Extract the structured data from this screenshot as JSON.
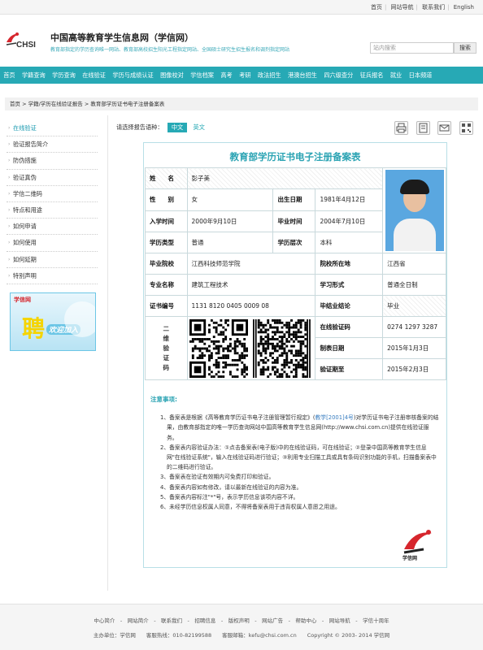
{
  "topbar": {
    "links": [
      "首页",
      "网站导航",
      "联系我们",
      "English"
    ]
  },
  "header": {
    "title": "中国高等教育学生信息网（学信网）",
    "logo_text": "CHSI",
    "subtitle": "教育部指定的学历查询唯一网站、教育部高校招生阳光工程指定网站、全国硕士研究生招生报名和调剂指定网站",
    "search_placeholder": "站内搜索",
    "search_button": "搜索"
  },
  "nav": [
    "首页",
    "学籍查询",
    "学历查询",
    "在线验证",
    "学历与成绩认证",
    "图像校对",
    "学信档案",
    "高考",
    "考研",
    "政法招生",
    "港澳台招生",
    "四六级查分",
    "征兵报名",
    "就业",
    "日本频道"
  ],
  "breadcrumb": "首页 > 学籍/学历在线验证报告 > 教育部学历证书电子注册备案表",
  "sidebar": {
    "items": [
      {
        "label": "在线验证",
        "active": true
      },
      {
        "label": "验证报告简介"
      },
      {
        "label": "防伪措施"
      },
      {
        "label": "验证真伪"
      },
      {
        "label": "学信二维码"
      },
      {
        "label": "特点和用途"
      },
      {
        "label": "如何申请"
      },
      {
        "label": "如何使用"
      },
      {
        "label": "如何延期"
      },
      {
        "label": "特别声明"
      }
    ],
    "ad": {
      "logo_text": "学信网",
      "big_char": "聘",
      "slogan": "欢迎加入"
    }
  },
  "lang": {
    "prompt": "请选择报告语种：",
    "zh": "中文",
    "en": "英文"
  },
  "tools": [
    "print-icon",
    "save-icon",
    "email-icon",
    "qrcode-icon"
  ],
  "report": {
    "title": "教育部学历证书电子注册备案表",
    "name_label": "姓　　名",
    "name": "彭子美",
    "gender_label": "性　　别",
    "gender": "女",
    "birth_label": "出生日期",
    "birth": "1981年4月12日",
    "enroll_label": "入学时间",
    "enroll": "2000年9月10日",
    "grad_label": "毕业时间",
    "grad": "2004年7月10日",
    "type_label": "学历类型",
    "type": "普通",
    "level_label": "学历层次",
    "level": "本科",
    "school_label": "毕业院校",
    "school": "江西科技师范学院",
    "loc_label": "院校所在地",
    "loc": "江西省",
    "major_label": "专业名称",
    "major": "建筑工程技术",
    "form_label": "学习形式",
    "form": "普通全日制",
    "cert_label": "证书编号",
    "cert": "1131 8120 0405 0009 08",
    "conclusion_label": "毕结业结论",
    "conclusion": "毕业",
    "qr_label": "二维验证码",
    "code_label": "在线验证码",
    "code": "0274 1297 3287",
    "made_label": "制表日期",
    "made": "2015年1月3日",
    "expire_label": "验证期至",
    "expire": "2015年2月3日"
  },
  "notes": {
    "heading": "注意事项:",
    "items": [
      {
        "pre": "1、备案表是根据《高等教育学历证书电子注册管理暂行规定》(",
        "link": "教学[2001]4号",
        "post": ")对学历证书电子注册审核备案的结果，由教育部指定的唯一学历查询网站中国高等教育学生信息网(http://www.chsi.com.cn)提供在线验证服务。"
      },
      {
        "pre": "2、备案表内容验证办法：①点击备案表(电子版)中的在线验证码，可在线验证；②登录中国高等教育学生信息网\"在线验证系统\"，输入在线验证码进行验证；③利用专业扫描工具或具有条码识别功能的手机，扫描备案表中的二维码进行验证。",
        "link": "",
        "post": ""
      },
      {
        "pre": "3、备案表在验证有效期内可免费打印和验证。",
        "link": "",
        "post": ""
      },
      {
        "pre": "4、备案表内容如有修改，请以最新在线验证的内容为准。",
        "link": "",
        "post": ""
      },
      {
        "pre": "5、备案表内容标注\"*\"号，表示学历信息该项内容不详。",
        "link": "",
        "post": ""
      },
      {
        "pre": "6、未经学历信息权属人同意，不得将备案表用于违背权属人意愿之用途。",
        "link": "",
        "post": ""
      }
    ],
    "stamp_text": "学信网"
  },
  "footer": {
    "line1": "中心简介　-　网站简介　-　联系我们　-　招聘信息　-　版权声明　-　网站广告　-　帮助中心　-　网站导航　-　学信十周年",
    "line2": "主办单位：学信网　　客服热线：010-82199588　　客服邮箱：kefu@chsi.com.cn　　Copyright © 2003- 2014 学信网"
  },
  "colors": {
    "accent": "#27a9b5",
    "title": "#2aa3b3"
  }
}
